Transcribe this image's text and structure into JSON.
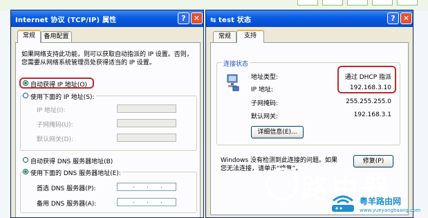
{
  "left_window": {
    "title": "Internet 协议 (TCP/IP) 属性",
    "help": "?",
    "close": "✕",
    "tabs": [
      "常规",
      "备用配置"
    ],
    "description_line1": "如果网络支持此功能，则可以获取自动指派的 IP 设置。否则，",
    "description_line2": "您需要从网络系统管理员处获得适当的 IP 设置。",
    "auto_ip_label": "自动获得 IP 地址(O)",
    "auto_ip_selected": true,
    "manual_ip_label": "使用下面的 IP 地址(S):",
    "ip_field_label": "IP 地址(I):",
    "mask_field_label": "子网掩码(U):",
    "gateway_field_label": "默认网关(D):",
    "auto_dns_label": "自动获得 DNS 服务器地址(B)",
    "manual_dns_label": "使用下面的 DNS 服务器地址(E):",
    "manual_dns_selected": true,
    "preferred_dns_label": "首选 DNS 服务器(P):",
    "alternate_dns_label": "备用 DNS 服务器(A):"
  },
  "right_window": {
    "title": "test 状态",
    "help": "?",
    "close": "✕",
    "tabs": [
      "常规",
      "支持"
    ],
    "group_title": "连接状态",
    "rows": [
      {
        "label": "地址类型:",
        "value": "通过 DHCP 指派"
      },
      {
        "label": "IP 地址:",
        "value": "192.168.3.10"
      },
      {
        "label": "子网掩码:",
        "value": "255.255.255.0"
      },
      {
        "label": "默认网关:",
        "value": "192.168.3.1"
      }
    ],
    "details_button": "详细信息(E)...",
    "repair_text_line1": "Windows 没有检测到此连接的问题。如果",
    "repair_text_line2": "您无法连接，请单击“修复”。",
    "repair_button": "修复(P)"
  },
  "watermark": {
    "brand_text": "路由器",
    "site_name": "粤羊路由网",
    "site_url": "www.yueyangbaang.com"
  },
  "colors": {
    "titlebar": "#0a5fe0",
    "dialog_bg": "#ece9d8",
    "highlight_red": "#c0282a",
    "radio_dot": "#21a121"
  }
}
